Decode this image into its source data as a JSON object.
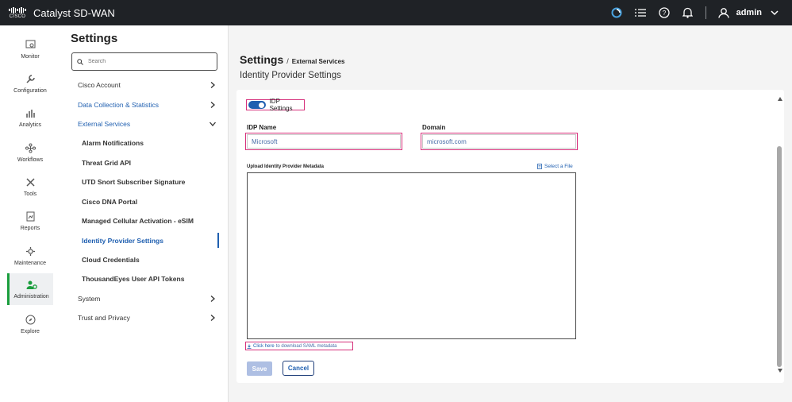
{
  "app": {
    "logo_text": "CISCO",
    "title": "Catalyst SD-WAN",
    "user": "admin"
  },
  "topbar_icons": [
    "sync-icon",
    "tasks-list-icon",
    "help-icon",
    "bell-icon",
    "user-icon",
    "chevron-down-icon"
  ],
  "leftnav": {
    "items": [
      {
        "label": "Monitor",
        "icon": "monitor-icon"
      },
      {
        "label": "Configuration",
        "icon": "wrench-icon"
      },
      {
        "label": "Analytics",
        "icon": "analytics-icon"
      },
      {
        "label": "Workflows",
        "icon": "workflows-icon"
      },
      {
        "label": "Tools",
        "icon": "tools-icon"
      },
      {
        "label": "Reports",
        "icon": "reports-icon"
      },
      {
        "label": "Maintenance",
        "icon": "gear-icon"
      },
      {
        "label": "Administration",
        "icon": "administration-icon",
        "active": true
      },
      {
        "label": "Explore",
        "icon": "compass-icon"
      }
    ]
  },
  "settings_panel": {
    "title": "Settings",
    "search_placeholder": "Search",
    "sections": [
      {
        "label": "Cisco Account"
      },
      {
        "label": "Data Collection & Statistics"
      },
      {
        "label": "External Services",
        "expanded": true
      }
    ],
    "sub_items": [
      {
        "label": "Alarm Notifications"
      },
      {
        "label": "Threat Grid API"
      },
      {
        "label": "UTD Snort Subscriber Signature"
      },
      {
        "label": "Cisco DNA Portal"
      },
      {
        "label": "Managed Cellular Activation - eSIM"
      },
      {
        "label": "Identity Provider Settings",
        "active": true
      },
      {
        "label": "Cloud Credentials"
      },
      {
        "label": "ThousandEyes User API Tokens"
      }
    ],
    "bottom_sections": [
      {
        "label": "System"
      },
      {
        "label": "Trust and Privacy"
      }
    ]
  },
  "main": {
    "breadcrumb_root": "Settings",
    "breadcrumb_sep": "/",
    "breadcrumb_current": "External Services",
    "page_title": "Identity Provider Settings",
    "idp_toggle_label": "IDP Settings",
    "idp_toggle_on": true,
    "idp_name_label": "IDP Name",
    "idp_name_value": "Microsoft",
    "domain_label": "Domain",
    "domain_value": "microsoft.com",
    "upload_label": "Upload Identity Provider Metadata",
    "select_file_label": "Select a File",
    "download_link_text": "Click here",
    "download_rest_text": "to download SAML metadata",
    "save_label": "Save",
    "cancel_label": "Cancel"
  },
  "colors": {
    "accent": "#1f5fb0",
    "highlight_outline": "#d6307b",
    "topbar": "#1f2226",
    "active_nav": "#1b9e3e"
  }
}
